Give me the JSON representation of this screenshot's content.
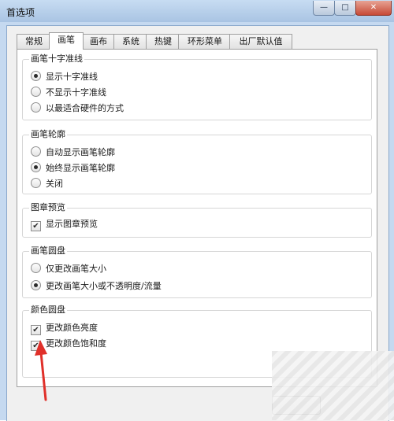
{
  "window": {
    "title": "首选项",
    "min_glyph": "—",
    "max_glyph": "□",
    "close_glyph": "✕"
  },
  "tabs": [
    {
      "label": "常规",
      "active": false
    },
    {
      "label": "画笔",
      "active": true
    },
    {
      "label": "画布",
      "active": false
    },
    {
      "label": "系统",
      "active": false
    },
    {
      "label": "热键",
      "active": false
    },
    {
      "label": "环形菜单",
      "active": false
    },
    {
      "label": "出厂默认值",
      "active": false
    }
  ],
  "groups": {
    "cursor": {
      "title": "画笔十字准线",
      "options": [
        {
          "label": "显示十字准线",
          "selected": true
        },
        {
          "label": "不显示十字准线",
          "selected": false
        },
        {
          "label": "以最适合硬件的方式",
          "selected": false
        }
      ]
    },
    "outline": {
      "title": "画笔轮廓",
      "options": [
        {
          "label": "自动显示画笔轮廓",
          "selected": false
        },
        {
          "label": "始终显示画笔轮廓",
          "selected": true
        },
        {
          "label": "关闭",
          "selected": false
        }
      ]
    },
    "stamp": {
      "title": "图章预览",
      "checkboxes": [
        {
          "label": "显示图章预览",
          "checked": true
        }
      ]
    },
    "puck": {
      "title": "画笔圆盘",
      "options": [
        {
          "label": "仅更改画笔大小",
          "selected": false
        },
        {
          "label": "更改画笔大小或不透明度/流量",
          "selected": true
        }
      ]
    },
    "color_puck": {
      "title": "颜色圆盘",
      "checkboxes": [
        {
          "label": "更改颜色亮度",
          "checked": true
        },
        {
          "label": "更改颜色饱和度",
          "checked": true
        }
      ]
    }
  },
  "colors": {
    "arrow": "#e0302a",
    "titlebar": "#b9d1ec",
    "close": "#c74a36"
  },
  "icons": {
    "check": "✔",
    "arrow": "red-arrow-annotation"
  }
}
